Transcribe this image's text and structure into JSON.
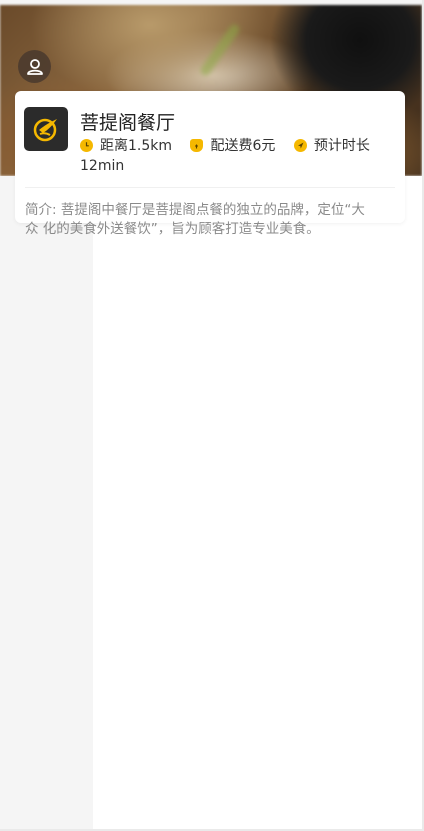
{
  "store": {
    "name": "菩提阁餐厅",
    "distance": "距离1.5km",
    "delivery_fee": "配送费6元",
    "eta": "预计时长12min",
    "intro": "简介: 菩提阁中餐厅是菩提阁点餐的独立的品牌，定位“大众 化的美食外送餐饮”，旨为顾客打造专业美食。"
  },
  "icons": {
    "user": "user-icon",
    "logo": "store-logo",
    "distance": "clock-icon",
    "fee": "money-bag-icon",
    "eta": "navigation-arrow-icon"
  },
  "colors": {
    "accent": "#f5b800",
    "intro_text": "#8a8a8a",
    "logo_bg": "#2b2b2b"
  }
}
